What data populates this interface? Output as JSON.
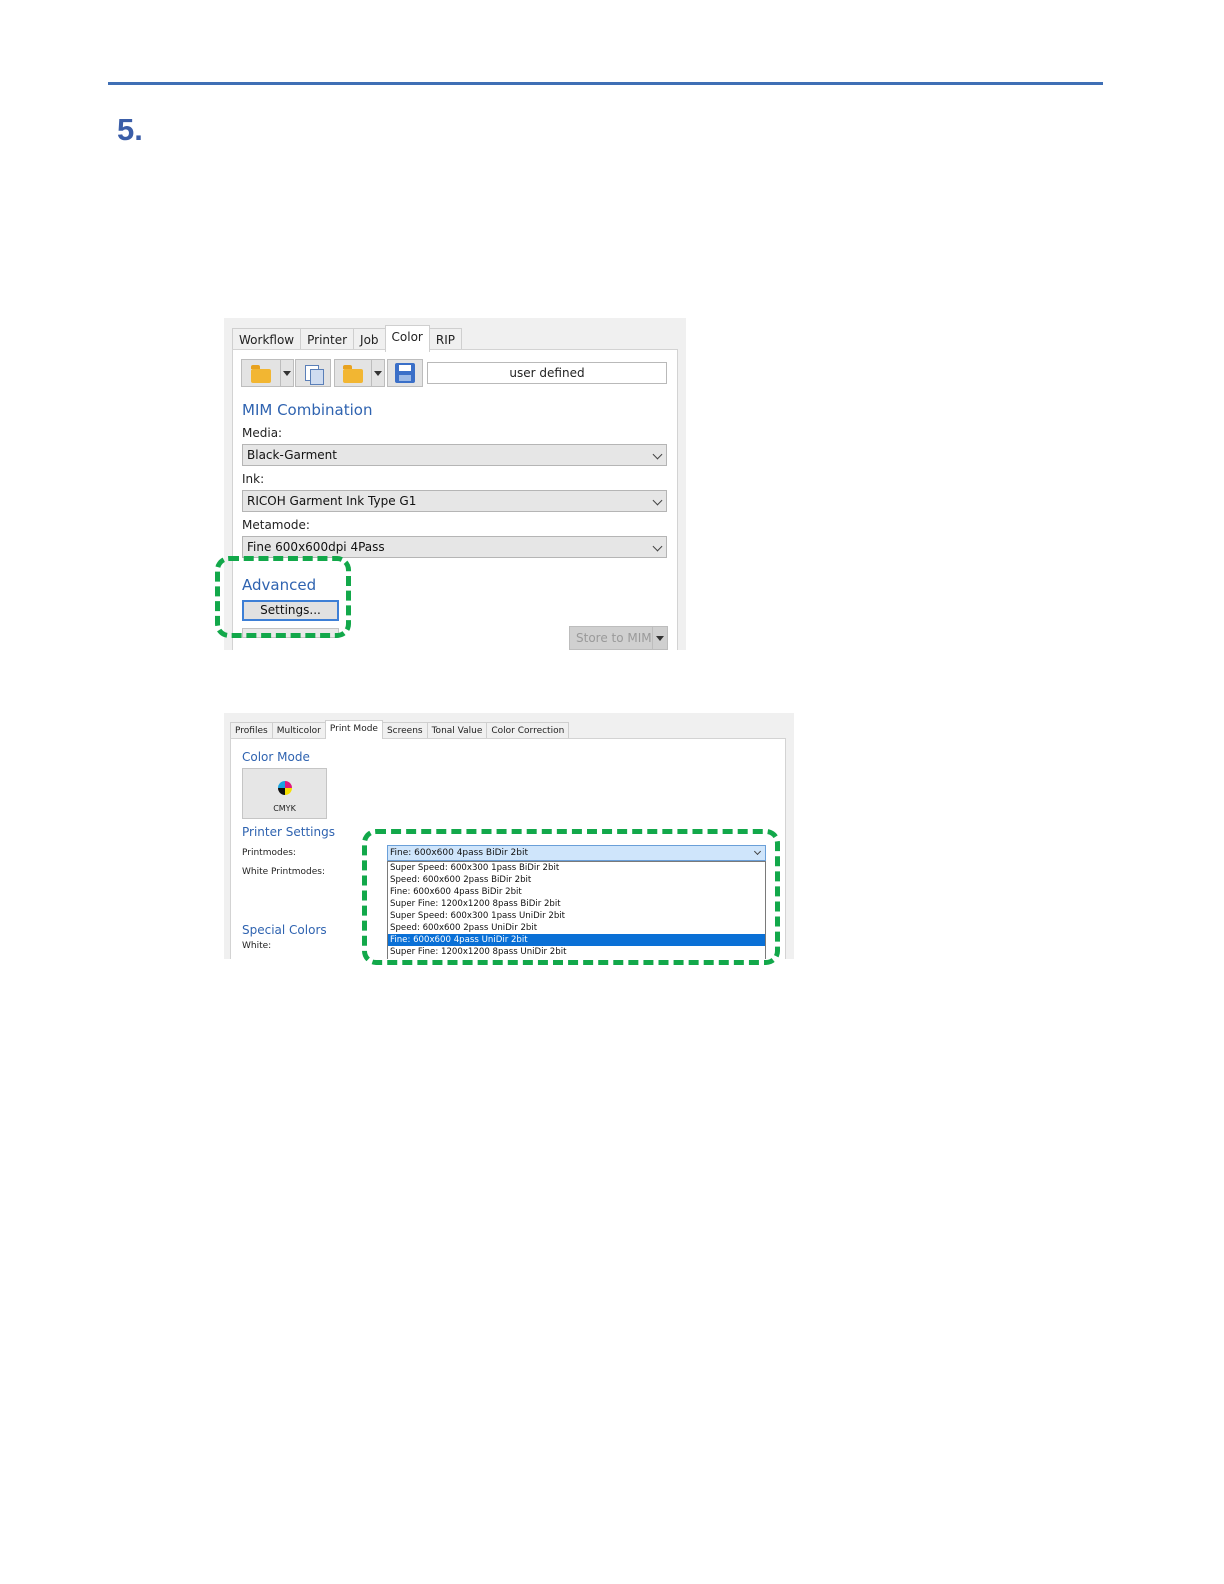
{
  "step_number": "5.",
  "screenshot1": {
    "tabs": [
      "Workflow",
      "Printer",
      "Job",
      "Color",
      "RIP"
    ],
    "active_tab": "Color",
    "toolbar": {
      "preset_field_value": "user defined",
      "icons": [
        "open-folder-icon",
        "dropdown-icon",
        "copy-icon",
        "open-folder-icon",
        "dropdown-icon",
        "save-disk-icon"
      ]
    },
    "mim_combination": {
      "title": "MIM Combination",
      "media_label": "Media:",
      "media_value": "Black-Garment",
      "ink_label": "Ink:",
      "ink_value": "RICOH Garment Ink Type G1",
      "metamode_label": "Metamode:",
      "metamode_value": "Fine 600x600dpi 4Pass"
    },
    "advanced": {
      "title": "Advanced",
      "settings_button": "Settings..."
    },
    "store_button": "Store to MIM",
    "highlight_color": "#12a84a"
  },
  "screenshot2": {
    "tabs": [
      "Profiles",
      "Multicolor",
      "Print Mode",
      "Screens",
      "Tonal Value",
      "Color Correction"
    ],
    "active_tab": "Print Mode",
    "color_mode": {
      "title": "Color Mode",
      "button_label": "CMYK"
    },
    "printer_settings": {
      "title": "Printer Settings",
      "printmodes_label": "Printmodes:",
      "white_printmodes_label": "White Printmodes:",
      "printmodes_value": "Fine: 600x600 4pass BiDir 2bit",
      "options": [
        "Super Speed: 600x300 1pass BiDir 2bit",
        "Speed: 600x600 2pass BiDir 2bit",
        "Fine: 600x600 4pass BiDir 2bit",
        "Super Fine: 1200x1200 8pass BiDir 2bit",
        "Super Speed: 600x300 1pass UniDir 2bit",
        "Speed: 600x600 2pass UniDir 2bit",
        "Fine: 600x600 4pass UniDir 2bit",
        "Super Fine: 1200x1200 8pass UniDir 2bit"
      ],
      "selected_option": "Fine: 600x600 4pass UniDir 2bit"
    },
    "special_colors": {
      "title": "Special Colors",
      "white_label": "White:"
    }
  }
}
